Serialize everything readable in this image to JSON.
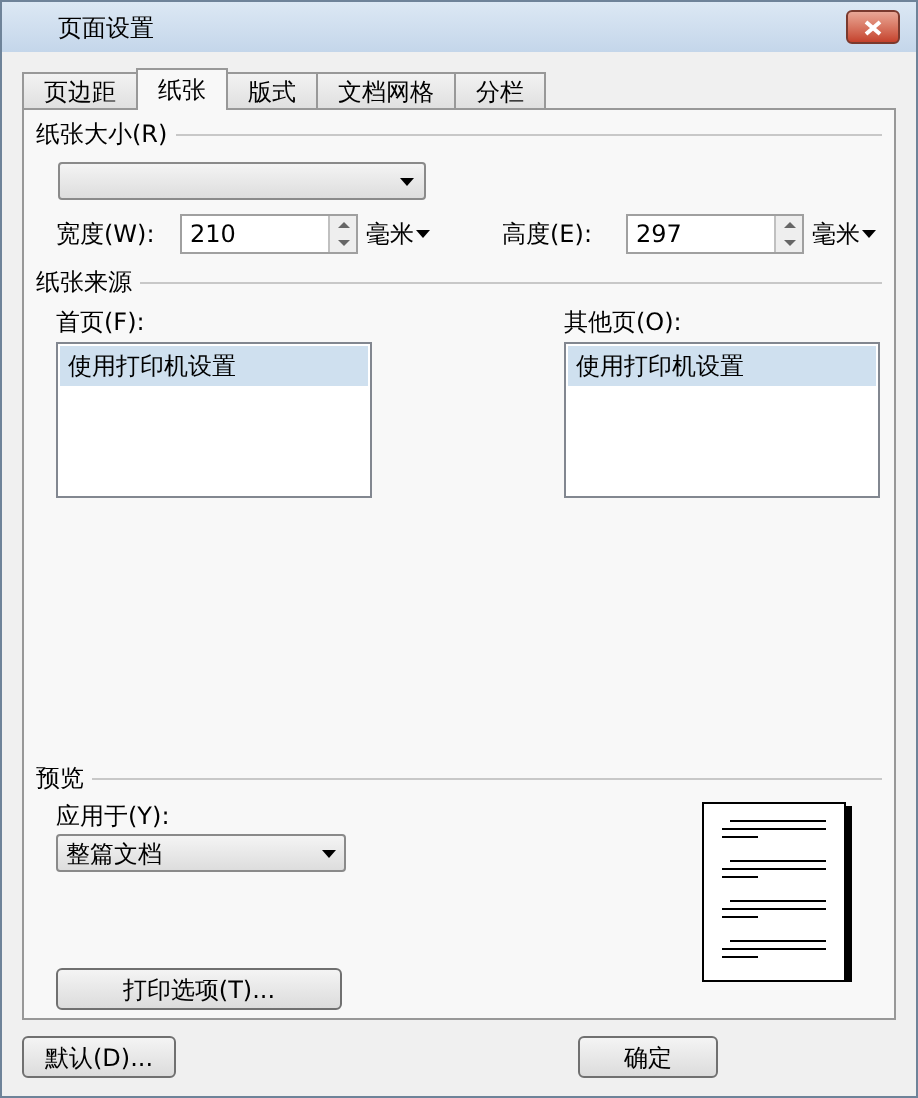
{
  "window": {
    "title": "页面设置"
  },
  "tabs": [
    {
      "label": "页边距",
      "selected": false
    },
    {
      "label": "纸张",
      "selected": true
    },
    {
      "label": "版式",
      "selected": false
    },
    {
      "label": "文档网格",
      "selected": false
    },
    {
      "label": "分栏",
      "selected": false
    }
  ],
  "paper_size": {
    "heading": "纸张大小(R)",
    "width": {
      "label": "宽度(W):",
      "value": "210",
      "unit": "毫米"
    },
    "height": {
      "label": "高度(E):",
      "value": "297",
      "unit": "毫米"
    }
  },
  "paper_source": {
    "heading": "纸张来源",
    "lists": [
      {
        "label": "首页(F):",
        "items": [
          {
            "text": "使用打印机设置",
            "selected": true
          }
        ]
      },
      {
        "label": "其他页(O):",
        "items": [
          {
            "text": "使用打印机设置",
            "selected": true
          }
        ]
      }
    ]
  },
  "preview": {
    "heading": "预览",
    "apply_to": {
      "label": "应用于(Y):",
      "value": "整篇文档"
    },
    "print_options_button": "打印选项(T)..."
  },
  "buttons": {
    "default": "默认(D)...",
    "ok": "确定"
  }
}
